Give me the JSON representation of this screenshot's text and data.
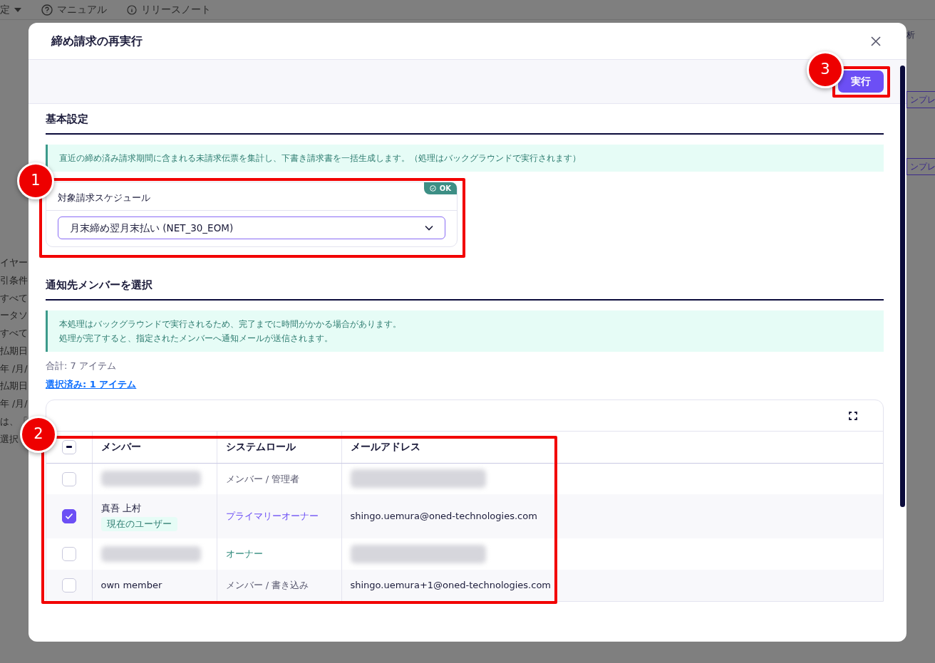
{
  "backdrop": {
    "top_menu": [
      {
        "label": "定",
        "kind": "dropdown"
      },
      {
        "label": "マニュアル",
        "kind": "help"
      },
      {
        "label": "リリースノート",
        "kind": "info"
      }
    ],
    "left_fragments": [
      "イヤー",
      "引条件",
      "すべて",
      "ータソ",
      "すべて",
      "払期日",
      "年 /月/",
      "払期日",
      "年 /月/",
      "は、「",
      "選択"
    ],
    "right_fragments": [
      "析",
      "ンプレ",
      "ンプレ"
    ]
  },
  "dialog": {
    "title": "締め請求の再実行",
    "run_button": "実行",
    "basic": {
      "heading": "基本設定",
      "notice": "直近の締め済み請求期間に含まれる未請求伝票を集計し、下書き請求書を一括生成します。（処理はバックグラウンドで実行されます）",
      "field": {
        "label": "対象請求スケジュール",
        "badge": "OK",
        "value": "月末締め翌月末払い (NET_30_EOM)"
      }
    },
    "members": {
      "heading": "通知先メンバーを選択",
      "notice": [
        "本処理はバックグラウンドで実行されるため、完了までに時間がかかる場合があります。",
        "処理が完了すると、指定されたメンバーへ通知メールが送信されます。"
      ],
      "total": "合計: 7 アイテム",
      "selected_count": "選択済み: 1 アイテム",
      "table": {
        "header_checkbox": {
          "indeterminate": true
        },
        "columns": [
          "メンバー",
          "システムロール",
          "メールアドレス"
        ],
        "rows": [
          {
            "checked": false,
            "member_hidden": true,
            "role": "メンバー / 管理者",
            "kind": "member",
            "email_hidden": true
          },
          {
            "checked": true,
            "member": "真吾 上村",
            "member_hidden": false,
            "tag": "現在のユーザー",
            "role": "プライマリーオーナー",
            "kind": "primary",
            "email": "shingo.uemura@oned-technologies.com",
            "email_hidden": false
          },
          {
            "checked": false,
            "member_hidden": true,
            "role": "オーナー",
            "kind": "owner",
            "email_hidden": true
          },
          {
            "checked": false,
            "member": "own member",
            "member_hidden": false,
            "role": "メンバー / 書き込み",
            "kind": "member",
            "email": "shingo.uemura+1@oned-technologies.com",
            "email_hidden": false
          }
        ]
      }
    }
  },
  "annotations": [
    {
      "number": "1"
    },
    {
      "number": "2"
    },
    {
      "number": "3"
    }
  ]
}
